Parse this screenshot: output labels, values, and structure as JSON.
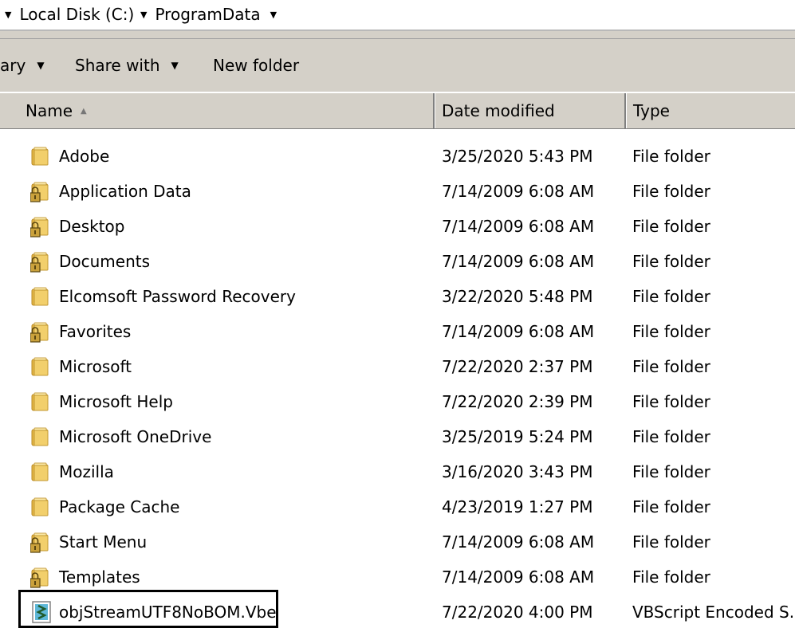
{
  "address_bar": {
    "crumbs": [
      "Local Disk (C:)",
      "ProgramData"
    ]
  },
  "toolbar": {
    "library_label": "ary",
    "share_label": "Share with",
    "new_folder_label": "New folder"
  },
  "columns": {
    "name": "Name",
    "date": "Date modified",
    "type": "Type"
  },
  "files": [
    {
      "name": "Adobe",
      "date": "3/25/2020 5:43 PM",
      "type": "File folder",
      "icon": "folder-icon"
    },
    {
      "name": "Application Data",
      "date": "7/14/2009 6:08 AM",
      "type": "File folder",
      "icon": "locked-folder-icon"
    },
    {
      "name": "Desktop",
      "date": "7/14/2009 6:08 AM",
      "type": "File folder",
      "icon": "locked-folder-icon"
    },
    {
      "name": "Documents",
      "date": "7/14/2009 6:08 AM",
      "type": "File folder",
      "icon": "locked-folder-icon"
    },
    {
      "name": "Elcomsoft Password Recovery",
      "date": "3/22/2020 5:48 PM",
      "type": "File folder",
      "icon": "folder-icon"
    },
    {
      "name": "Favorites",
      "date": "7/14/2009 6:08 AM",
      "type": "File folder",
      "icon": "locked-folder-icon"
    },
    {
      "name": "Microsoft",
      "date": "7/22/2020 2:37 PM",
      "type": "File folder",
      "icon": "folder-icon"
    },
    {
      "name": "Microsoft Help",
      "date": "7/22/2020 2:39 PM",
      "type": "File folder",
      "icon": "folder-icon"
    },
    {
      "name": "Microsoft OneDrive",
      "date": "3/25/2019 5:24 PM",
      "type": "File folder",
      "icon": "folder-icon"
    },
    {
      "name": "Mozilla",
      "date": "3/16/2020 3:43 PM",
      "type": "File folder",
      "icon": "folder-icon"
    },
    {
      "name": "Package Cache",
      "date": "4/23/2019 1:27 PM",
      "type": "File folder",
      "icon": "folder-icon"
    },
    {
      "name": "Start Menu",
      "date": "7/14/2009 6:08 AM",
      "type": "File folder",
      "icon": "locked-folder-icon"
    },
    {
      "name": "Templates",
      "date": "7/14/2009 6:08 AM",
      "type": "File folder",
      "icon": "locked-folder-icon"
    },
    {
      "name": "objStreamUTF8NoBOM.Vbe",
      "date": "7/22/2020 4:00 PM",
      "type": "VBScript Encoded S...",
      "icon": "vbscript-file-icon"
    }
  ]
}
